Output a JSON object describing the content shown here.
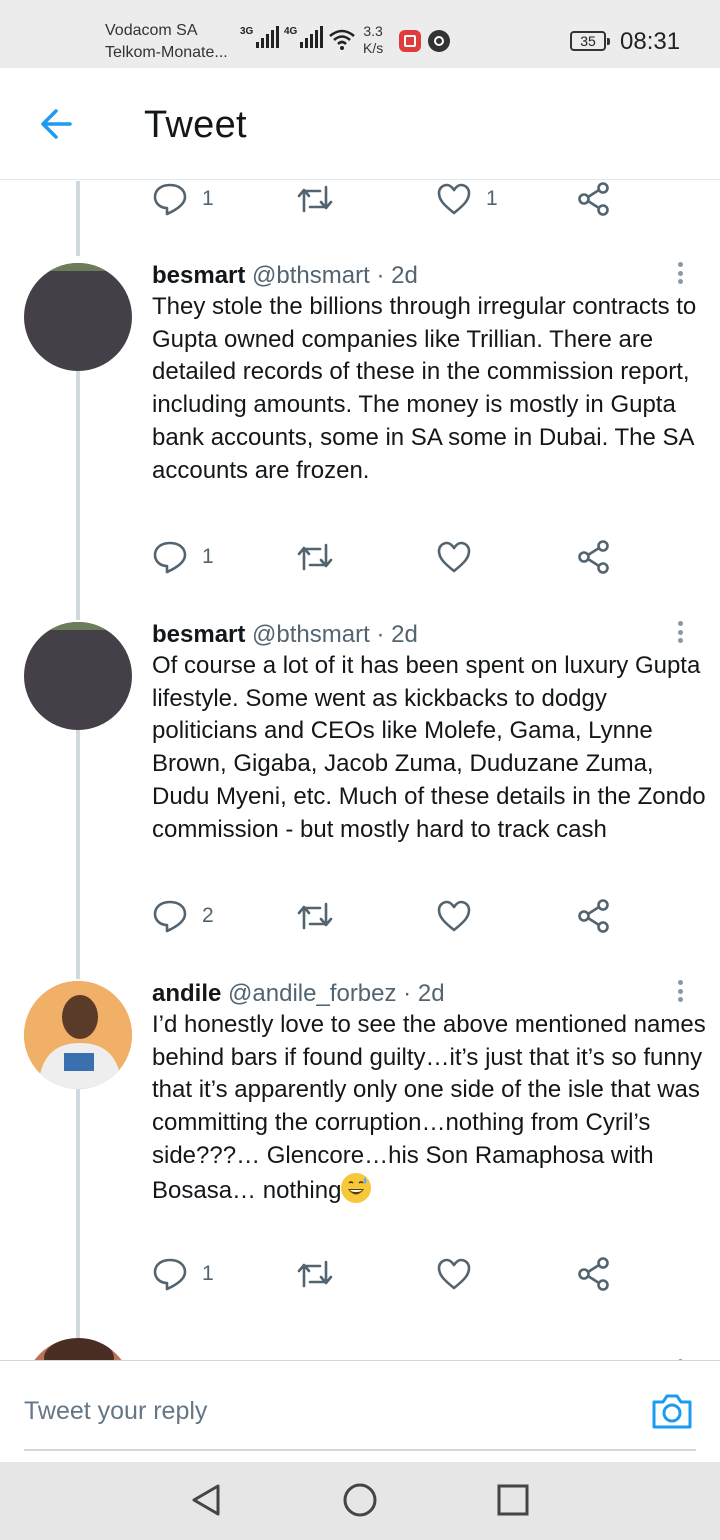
{
  "status_bar": {
    "carrier_1": "Vodacom SA",
    "carrier_2": "Telkom-Monate...",
    "network_1": "3G",
    "network_2": "4G",
    "speed_value": "3.3",
    "speed_unit": "K/s",
    "battery": "35",
    "time": "08:31"
  },
  "header": {
    "back_icon": "arrow-left-icon",
    "title": "Tweet"
  },
  "top_actions": {
    "reply_count": "1",
    "like_count": "1"
  },
  "tweets": [
    {
      "name": "besmart",
      "handle": "@bthsmart",
      "separator": "·",
      "time": "2d",
      "text": "They stole the billions through irregular contracts to Gupta owned companies like Trillian. There are detailed records of these in the commission report, including amounts. The money is mostly in Gupta bank accounts, some in SA some in Dubai. The SA accounts are frozen.",
      "reply_count": "1",
      "like_count": ""
    },
    {
      "name": "besmart",
      "handle": "@bthsmart",
      "separator": "·",
      "time": "2d",
      "text": "Of course a lot of it has been spent on luxury Gupta lifestyle. Some went as kickbacks to dodgy politicians and CEOs like Molefe, Gama, Lynne Brown, Gigaba, Jacob Zuma, Duduzane Zuma, Dudu Myeni, etc. Much of these details in the Zondo commission - but mostly hard to track cash",
      "reply_count": "2",
      "like_count": ""
    },
    {
      "name": "andile",
      "handle": "@andile_forbez",
      "separator": "·",
      "time": "2d",
      "text": "I’d honestly love to see the above mentioned names behind bars if found guilty…it’s just that it’s so funny that it’s apparently only one side of the isle that was committing the corruption…nothing from Cyril’s side???… Glencore…his Son Ramaphosa with Bosasa… nothing",
      "emoji": "grinning-face-with-sweat-emoji",
      "reply_count": "1",
      "like_count": ""
    }
  ],
  "reply_bar": {
    "placeholder": "Tweet your reply",
    "camera_icon": "camera-icon"
  },
  "nav_bar": {
    "back": "triangle-back-icon",
    "home": "circle-home-icon",
    "recents": "square-recents-icon"
  },
  "colors": {
    "accent": "#1d9bf0",
    "icon_gray": "#536471",
    "thread_line": "#cfd9de",
    "avatar_dark": "#453f48"
  }
}
